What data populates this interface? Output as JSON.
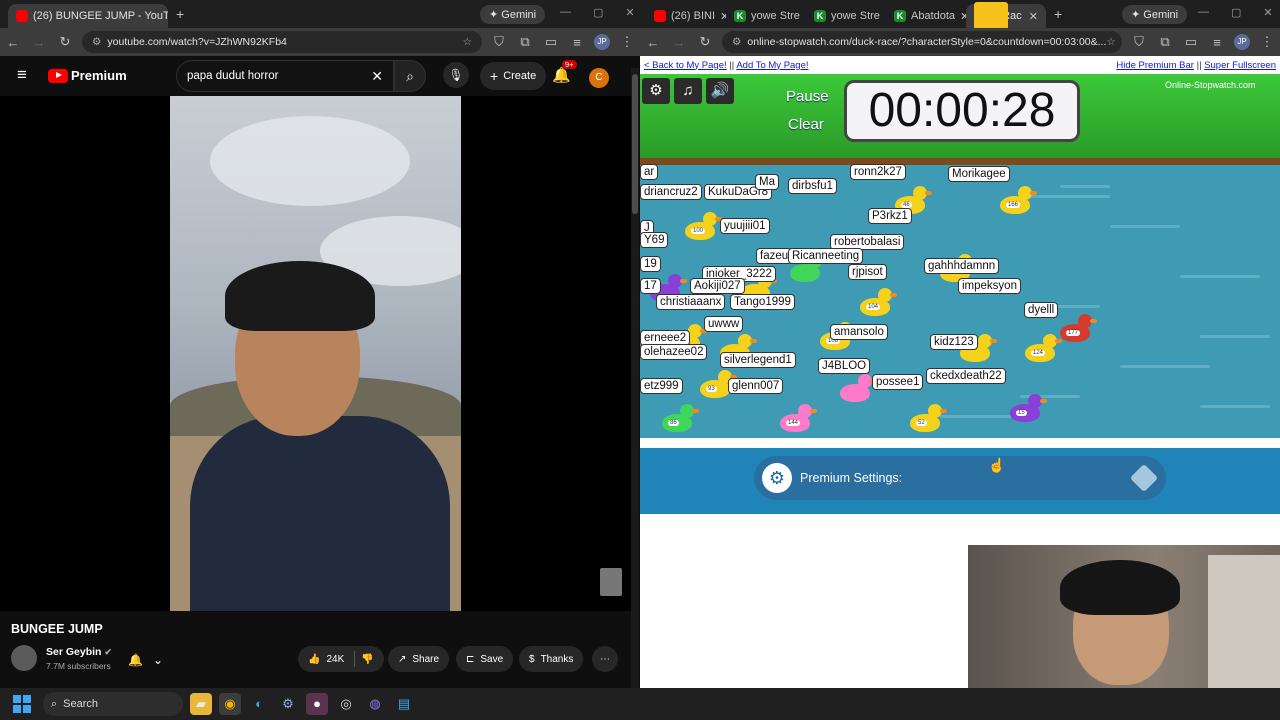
{
  "left": {
    "tab_title": "(26) BUNGEE JUMP - YouTu",
    "gemini": "Gemini",
    "url": "youtube.com/watch?v=JZhWN92KFb4",
    "profile": "JP",
    "yt": {
      "logo": "Premium",
      "search_value": "papa dudut horror",
      "create": "Create",
      "notif_badge": "9+",
      "avatar": "C",
      "video_title": "BUNGEE JUMP",
      "channel": "Ser Geybin",
      "subscribers": "7.7M subscribers",
      "likes": "24K",
      "share": "Share",
      "save": "Save",
      "thanks": "Thanks"
    }
  },
  "right": {
    "tabs": [
      {
        "label": "(26) BINI",
        "icon": "youtube"
      },
      {
        "label": "yowe Stre",
        "icon": "kick"
      },
      {
        "label": "yowe Stre",
        "icon": "kick"
      },
      {
        "label": "Abatdota",
        "icon": "kick"
      },
      {
        "label": "Duck Rac",
        "icon": "duck",
        "active": true
      }
    ],
    "gemini": "Gemini",
    "url": "online-stopwatch.com/duck-race/?characterStyle=0&countdown=00:03:00&...",
    "profile": "JP",
    "links": {
      "back": "< Back to My Page!",
      "sep": "||",
      "add": "Add To My Page!",
      "hide": "Hide Premium Bar",
      "full": "Super Fullscreen"
    },
    "game": {
      "pause": "Pause",
      "clear": "Clear",
      "timer": "00:00:28",
      "brand": "Online-Stopwatch.com"
    },
    "names": [
      "ar",
      "driancruz2",
      "KukuDaGr8",
      "Ma",
      "dirbsfu1",
      "ronn2k27",
      "Morikagee",
      "J",
      "yuujiii01",
      "P3rkz1",
      "19",
      "robertobalasi",
      "fazeu",
      "Ricanneeting",
      "gahhhdamnn",
      "Y69",
      "inioker_3222",
      "rjpisot",
      "17",
      "Aokiji027",
      "impeksyon",
      "christiaaanx",
      "Tango1999",
      "dyelll",
      "uwww",
      "amansolo",
      "erneee2",
      "kidz123",
      "olehazee02",
      "J4BLOO",
      "silverlegend1",
      "ckedxdeath22",
      "etz999",
      "glenn007",
      "possee1"
    ],
    "duck_numbers": [
      "46",
      "166",
      "100",
      "86",
      "144",
      "52",
      "15",
      "104",
      "177",
      "124",
      "108",
      "93"
    ],
    "premium": "Premium Settings:"
  },
  "taskbar": {
    "search": "Search"
  }
}
